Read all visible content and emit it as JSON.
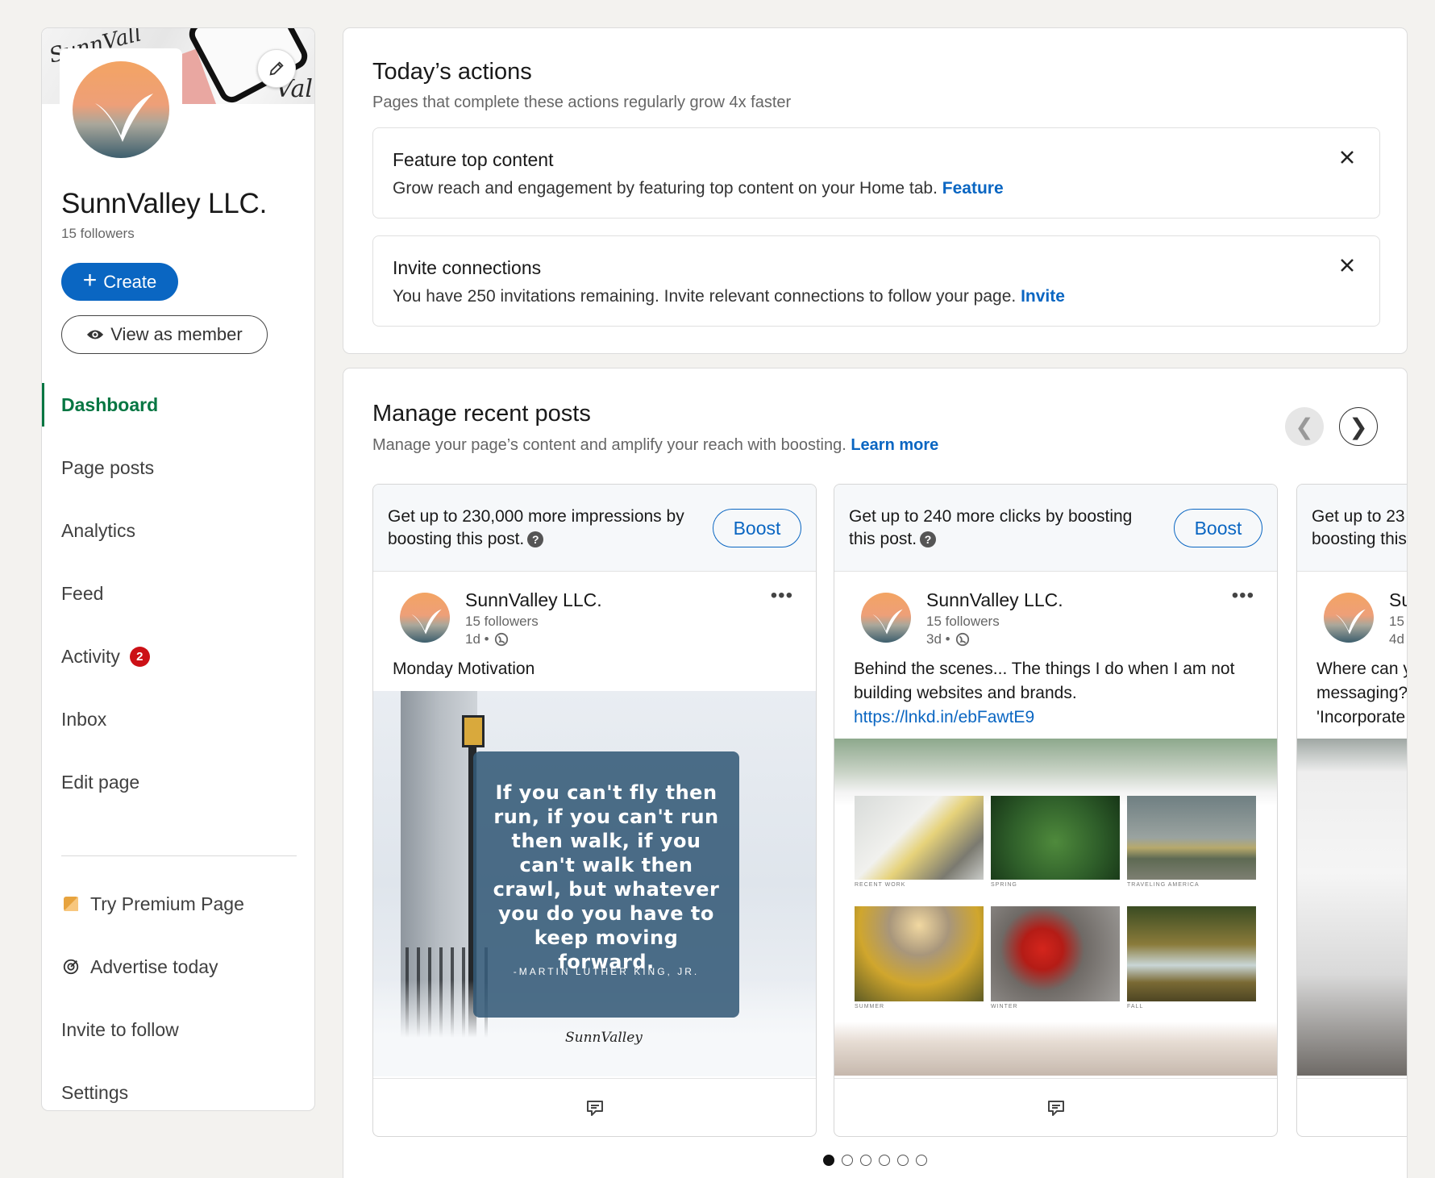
{
  "sidebar": {
    "cover": {
      "scribble_left": "SunnVall",
      "scribble_right": "Val"
    },
    "company_name": "SunnValley LLC.",
    "followers": "15 followers",
    "create_label": "Create",
    "view_as_member_label": "View as member",
    "nav": [
      {
        "label": "Dashboard",
        "active": true
      },
      {
        "label": "Page posts"
      },
      {
        "label": "Analytics"
      },
      {
        "label": "Feed"
      },
      {
        "label": "Activity",
        "badge": "2"
      },
      {
        "label": "Inbox"
      },
      {
        "label": "Edit page"
      }
    ],
    "secondary": [
      {
        "label": "Try Premium Page",
        "icon": "premium-icon"
      },
      {
        "label": "Advertise today",
        "icon": "target-icon"
      },
      {
        "label": "Invite to follow"
      },
      {
        "label": "Settings"
      }
    ]
  },
  "actions": {
    "title": "Today’s actions",
    "subtitle": "Pages that complete these actions regularly grow 4x faster",
    "items": [
      {
        "title": "Feature top content",
        "text": "Grow reach and engagement by featuring top content on your Home tab.",
        "link": "Feature"
      },
      {
        "title": "Invite connections",
        "text": "You have 250 invitations remaining. Invite relevant connections to follow your page.",
        "link": "Invite"
      }
    ]
  },
  "posts": {
    "title": "Manage recent posts",
    "subtitle": "Manage your page’s content and amplify your reach with boosting.",
    "learn_more": "Learn more",
    "boost_label": "Boost",
    "items": [
      {
        "boost_text": "Get up to 230,000 more impressions by boosting this post.",
        "author": "SunnValley LLC.",
        "followers": "15 followers",
        "time": "1d •",
        "text": "Monday Motivation",
        "quote": "If you can't fly then run, if you can't run then walk, if you can't walk then crawl, but whatever you do you have to keep moving forward.",
        "quote_author": "-MARTIN LUTHER KING, JR.",
        "signature": "SunnValley"
      },
      {
        "boost_text": "Get up to 240 more clicks by boosting this post.",
        "author": "SunnValley LLC.",
        "followers": "15 followers",
        "time": "3d •",
        "text": "Behind the scenes... The things I do when I am not building websites and brands.",
        "link": "https://lnkd.in/ebFawtE9",
        "tiles": [
          "Recent Work",
          "Spring",
          "Traveling America",
          "Summer",
          "Winter",
          "Fall"
        ]
      },
      {
        "boost_text": "Get up to 23",
        "boost_text2": "boosting this",
        "author": "Su",
        "followers": "15",
        "time": "4d",
        "text1": "Where can y",
        "text2": "messaging?",
        "text3": "'Incorporate"
      }
    ],
    "pager": {
      "count": 6,
      "active": 1
    }
  }
}
